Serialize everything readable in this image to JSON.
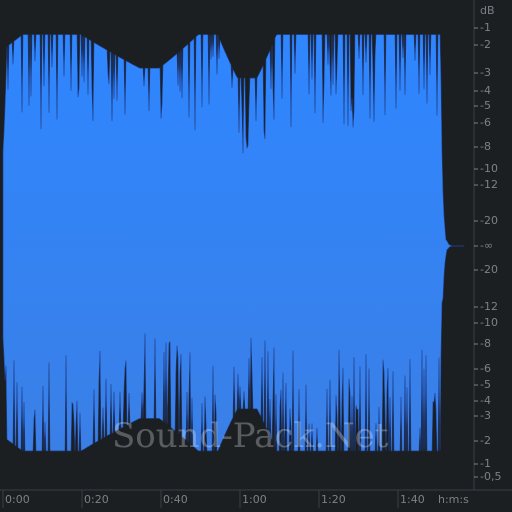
{
  "editor": {
    "unit_label": "dB",
    "time_unit_label": "h:m:s",
    "watermark": "Sound-Pack.Net"
  },
  "colors": {
    "background": "#1b1f22",
    "waveform_top": "#2f86ff",
    "waveform_bottom": "#3a7fe6",
    "outline": "#1f3f8a",
    "ruler_line": "#3a3f44",
    "label": "#7c8185"
  },
  "chart_data": {
    "type": "area",
    "title": "",
    "xlabel": "h:m:s",
    "ylabel": "dB",
    "x_range_seconds": [
      0,
      118
    ],
    "time_ticks": [
      "0:00",
      "0:20",
      "0:40",
      "1:00",
      "1:20",
      "1:40"
    ],
    "db_ticks_upper": [
      "dB",
      "-1",
      "-2",
      "-3",
      "-4",
      "-5",
      "-6",
      "-8",
      "-10",
      "-12",
      "-20",
      "-∞"
    ],
    "db_ticks_lower": [
      "-20",
      "-12",
      "-10",
      "-8",
      "-6",
      "-5",
      "-4",
      "-3",
      "-2",
      "-1",
      "-0,5"
    ],
    "peak_envelope_db": {
      "seconds": [
        0,
        1,
        5,
        10,
        20,
        30,
        35,
        40,
        50,
        55,
        60,
        65,
        70,
        75,
        80,
        90,
        100,
        110,
        112,
        113,
        115,
        118
      ],
      "peak": [
        -8,
        -1.5,
        -1,
        -1,
        -1,
        -2,
        -2.5,
        -2.5,
        -1,
        -1,
        -3,
        -3,
        -1,
        -1,
        -1,
        -1,
        -1,
        -1,
        -1,
        -20,
        -60,
        -60
      ]
    }
  }
}
